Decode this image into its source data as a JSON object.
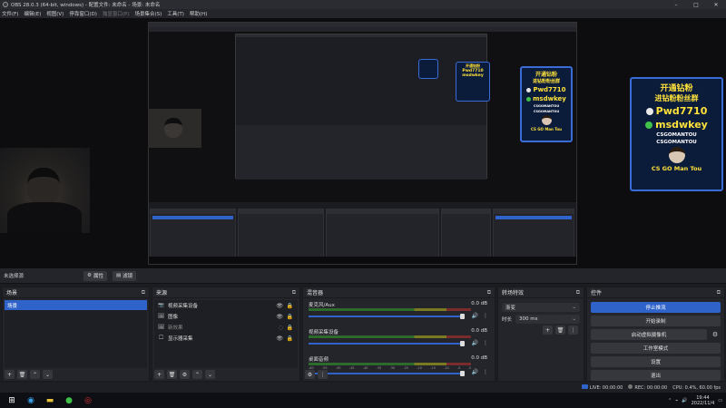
{
  "window": {
    "title": "OBS 28.0.3 (64-bit, windows) - 配置文件: 未命名 - 场景: 未命名",
    "controls": [
      "–",
      "□",
      "✕"
    ]
  },
  "menu": [
    {
      "label": "文件(F)",
      "enabled": true
    },
    {
      "label": "编辑(E)",
      "enabled": true
    },
    {
      "label": "视图(V)",
      "enabled": true
    },
    {
      "label": "停靠窗口(D)",
      "enabled": true
    },
    {
      "label": "独显窗口(P)",
      "enabled": false
    },
    {
      "label": "场景集合(S)",
      "enabled": true
    },
    {
      "label": "工具(T)",
      "enabled": true
    },
    {
      "label": "帮助(H)",
      "enabled": true
    }
  ],
  "promo": {
    "line1": "开通钻粉",
    "line2": "进钻粉粉丝群",
    "qq_value": "Pwd7710",
    "wechat_value": "msdwkey",
    "social1": "CSGOMANTOU",
    "social2": "CSGOMANTOU",
    "footer": "CS GO Man Tou"
  },
  "source_bar": {
    "label": "未选择源",
    "properties": "属性",
    "filters": "滤镜"
  },
  "scenes": {
    "title": "场景",
    "items": [
      "场景"
    ]
  },
  "sources": {
    "title": "来源",
    "items": [
      {
        "icon": "📷",
        "label": "视频采集设备",
        "visible": true
      },
      {
        "icon": "🖼",
        "label": "图像",
        "visible": true
      },
      {
        "icon": "🖼",
        "label": "新效果",
        "visible": false
      },
      {
        "icon": "🖵",
        "label": "显示器采集",
        "visible": true
      }
    ]
  },
  "mixer": {
    "title": "混音器",
    "channels": [
      {
        "name": "麦克风/Aux",
        "db": "0.0 dB"
      },
      {
        "name": "视频采集设备",
        "db": "0.0 dB"
      },
      {
        "name": "桌面音频",
        "db": "0.0 dB"
      }
    ],
    "scale": [
      "-60",
      "-55",
      "-50",
      "-45",
      "-40",
      "-35",
      "-30",
      "-25",
      "-20",
      "-15",
      "-10",
      "-5",
      "0"
    ]
  },
  "transitions": {
    "title": "转场特效",
    "type": "渐变",
    "duration_label": "时长",
    "duration_value": "300 ms"
  },
  "controls": {
    "title": "控件",
    "buttons": [
      "停止推流",
      "开始录制",
      "启动虚拟摄像机",
      "工作室模式",
      "设置",
      "退出"
    ]
  },
  "status": {
    "live": "LIVE: 00:00:00",
    "rec": "REC: 00:00:00",
    "cpu": "CPU: 0.4%, 60.00 fps"
  },
  "taskbar": {
    "time": "19:44",
    "date": "2022/11/4"
  },
  "colors": {
    "accent": "#2f63c9",
    "panel": "#24252b",
    "background": "#1c1d22",
    "promo_text": "#ffe23a"
  }
}
